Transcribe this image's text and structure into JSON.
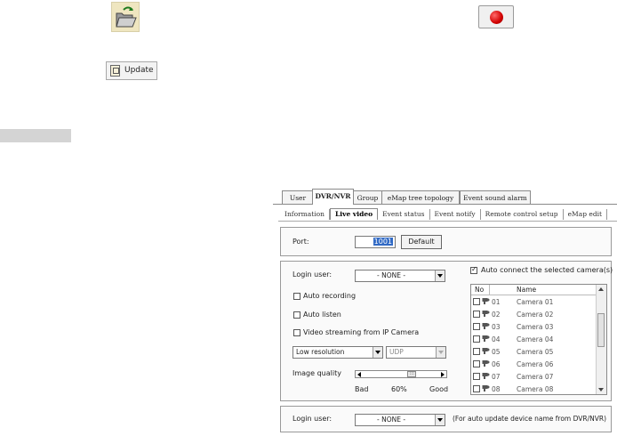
{
  "toolbar": {
    "open_icon": "open-folder-icon",
    "record_icon": "record-icon",
    "update_label": "Update",
    "update_icon": "clipboard-icon"
  },
  "dialog": {
    "tabs": [
      {
        "label": "User"
      },
      {
        "label": "DVR/NVR"
      },
      {
        "label": "Group"
      },
      {
        "label": "eMap tree topology"
      },
      {
        "label": "Event sound alarm"
      }
    ],
    "subtabs": [
      {
        "label": "Information"
      },
      {
        "label": "Live video"
      },
      {
        "label": "Event status"
      },
      {
        "label": "Event notify"
      },
      {
        "label": "Remote control setup"
      },
      {
        "label": "eMap edit"
      }
    ],
    "port_label": "Port:",
    "port_value": "1001",
    "default_button": "Default",
    "login_user_label": "Login user:",
    "login_user_value": "- NONE -",
    "auto_connect_label": "Auto connect the selected camera(s)",
    "auto_recording_label": "Auto recording",
    "auto_listen_label": "Auto listen",
    "video_streaming_label": "Video streaming from IP Camera",
    "resolution_value": "Low resolution",
    "protocol_value": "UDP",
    "image_quality_label": "Image quality",
    "quality_bad": "Bad",
    "quality_value": "60%",
    "quality_good": "Good",
    "quality_level": 0.6,
    "list_header_no": "No",
    "list_header_name": "Name",
    "cameras": [
      {
        "no": "01",
        "name": "Camera 01"
      },
      {
        "no": "02",
        "name": "Camera 02"
      },
      {
        "no": "03",
        "name": "Camera 03"
      },
      {
        "no": "04",
        "name": "Camera 04"
      },
      {
        "no": "05",
        "name": "Camera 05"
      },
      {
        "no": "06",
        "name": "Camera 06"
      },
      {
        "no": "07",
        "name": "Camera 07"
      },
      {
        "no": "08",
        "name": "Camera 08"
      }
    ],
    "bottom_login_label": "Login user:",
    "bottom_login_value": "- NONE -",
    "bottom_note": "(For auto update device name from DVR/NVR)"
  }
}
